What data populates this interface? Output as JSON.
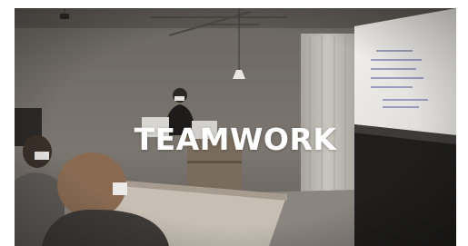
{
  "overlay": {
    "title": "TEAMWORK"
  },
  "scene": {
    "description_icons": [
      "projector-screen",
      "presenter",
      "ceiling-lamp",
      "curtain",
      "desk",
      "monitor",
      "audience-member"
    ]
  },
  "colors": {
    "title": "#ffffff",
    "wall": "#75716c",
    "screen": "#ecebe8"
  }
}
